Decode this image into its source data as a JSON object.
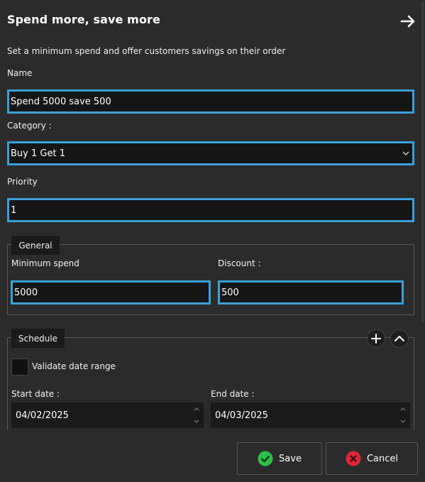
{
  "header": {
    "title": "Spend more, save more",
    "subtitle": "Set a minimum spend and offer customers savings on their order"
  },
  "form": {
    "name_label": "Name",
    "name_value": "Spend 5000 save 500",
    "category_label": "Category :",
    "category_value": "Buy 1 Get 1",
    "priority_label": "Priority",
    "priority_value": "1"
  },
  "general": {
    "legend": "General",
    "min_spend_label": "Minimum spend",
    "min_spend_value": "5000",
    "discount_label": "Discount :",
    "discount_value": "500"
  },
  "schedule": {
    "legend": "Schedule",
    "validate_label": "Validate date range",
    "start_label": "Start date :",
    "start_value": "04/02/2025",
    "end_label": "End date :",
    "end_value": "04/03/2025"
  },
  "footer": {
    "save_label": "Save",
    "cancel_label": "Cancel"
  },
  "colors": {
    "accent": "#3aa0d8",
    "background": "#2b2b2b",
    "save_icon": "#2fbf4a",
    "cancel_icon": "#e0263a"
  },
  "icons": [
    "arrow-right-icon",
    "chevron-down-icon",
    "plus-icon",
    "chevron-up-icon",
    "check-circle-icon",
    "x-circle-icon"
  ]
}
